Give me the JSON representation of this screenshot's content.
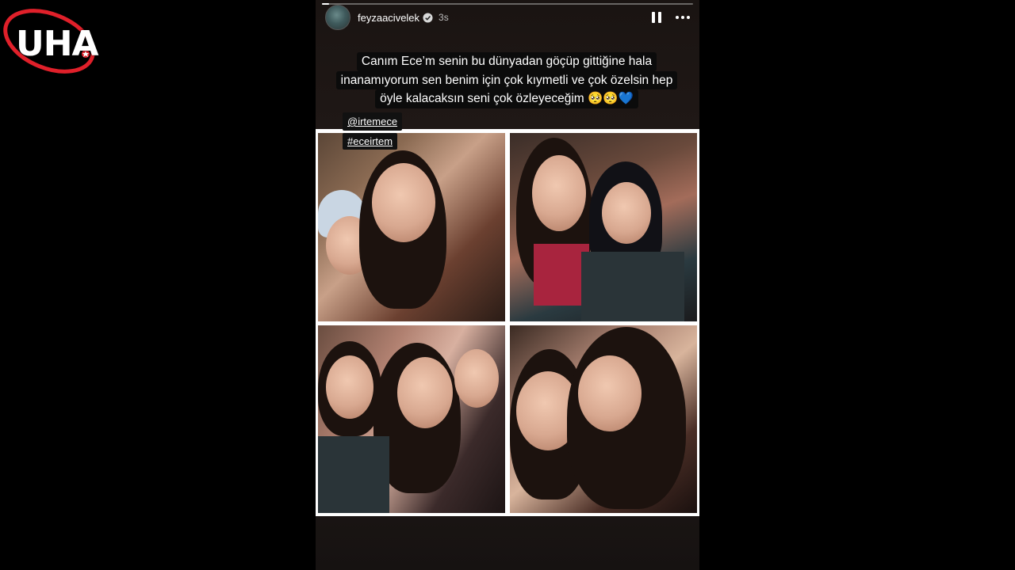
{
  "watermark": {
    "text": "UHA",
    "icon": "uha-logo"
  },
  "story": {
    "progress": 0.02,
    "username": "feyzaacivelek",
    "verified_icon": "verified-badge",
    "time": "3s",
    "pause_icon": "pause-icon",
    "more_icon": "more-icon",
    "caption_lines": [
      "Canım Ece’m senin  bu dünyadan göçüp gittiğine hala",
      "inanamıyorum sen benim için çok kıymetli ve çok özelsin hep",
      "öyle kalacaksın seni çok özleyeceğim 🥺🥺💙"
    ],
    "mention": "@irtemece",
    "hashtag": "#eceirtem"
  },
  "colors": {
    "accent_red": "#e0202a",
    "story_bg": "#1f1816"
  }
}
